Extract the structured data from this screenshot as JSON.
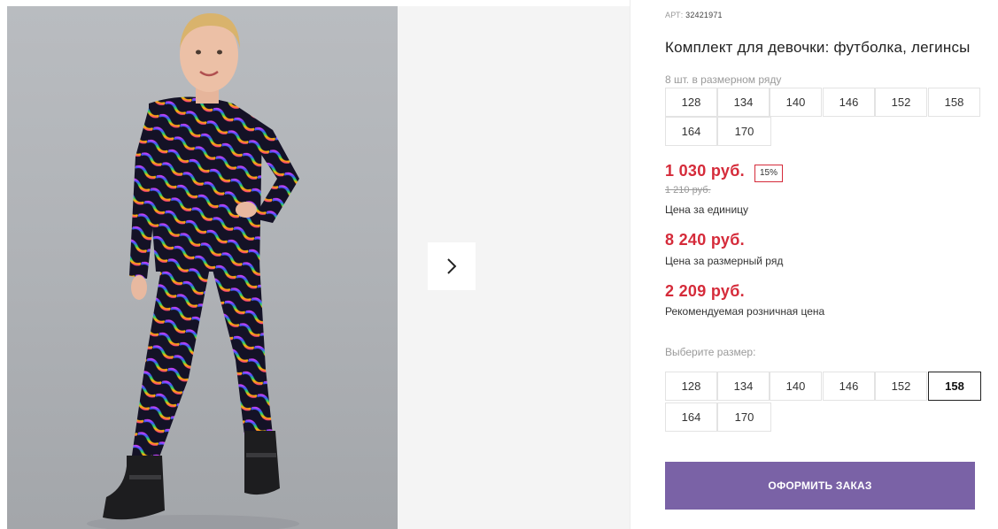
{
  "product": {
    "art_label": "АРТ:",
    "art_number": "32421971",
    "title": "Комплект для девочки: футболка, легинсы"
  },
  "size_range": {
    "caption": "8 шт. в размерном ряду",
    "sizes": [
      "128",
      "134",
      "140",
      "146",
      "152",
      "158",
      "164",
      "170"
    ]
  },
  "pricing": {
    "unit_price": "1 030 руб.",
    "discount_badge": "15%",
    "old_price": "1 210 руб.",
    "unit_label": "Цена за единицу",
    "range_price": "8 240 руб.",
    "range_label": "Цена за размерный ряд",
    "retail_price": "2 209 руб.",
    "retail_label": "Рекомендуемая розничная цена"
  },
  "size_select": {
    "caption": "Выберите размер:",
    "sizes": [
      "128",
      "134",
      "140",
      "146",
      "152",
      "158",
      "164",
      "170"
    ],
    "selected": "158"
  },
  "order_button": "ОФОРМИТЬ ЗАКАЗ",
  "gallery": {
    "next_icon": "chevron-right-icon"
  },
  "colors": {
    "price_red": "#d52b3a",
    "order_purple": "#7a62a6"
  }
}
